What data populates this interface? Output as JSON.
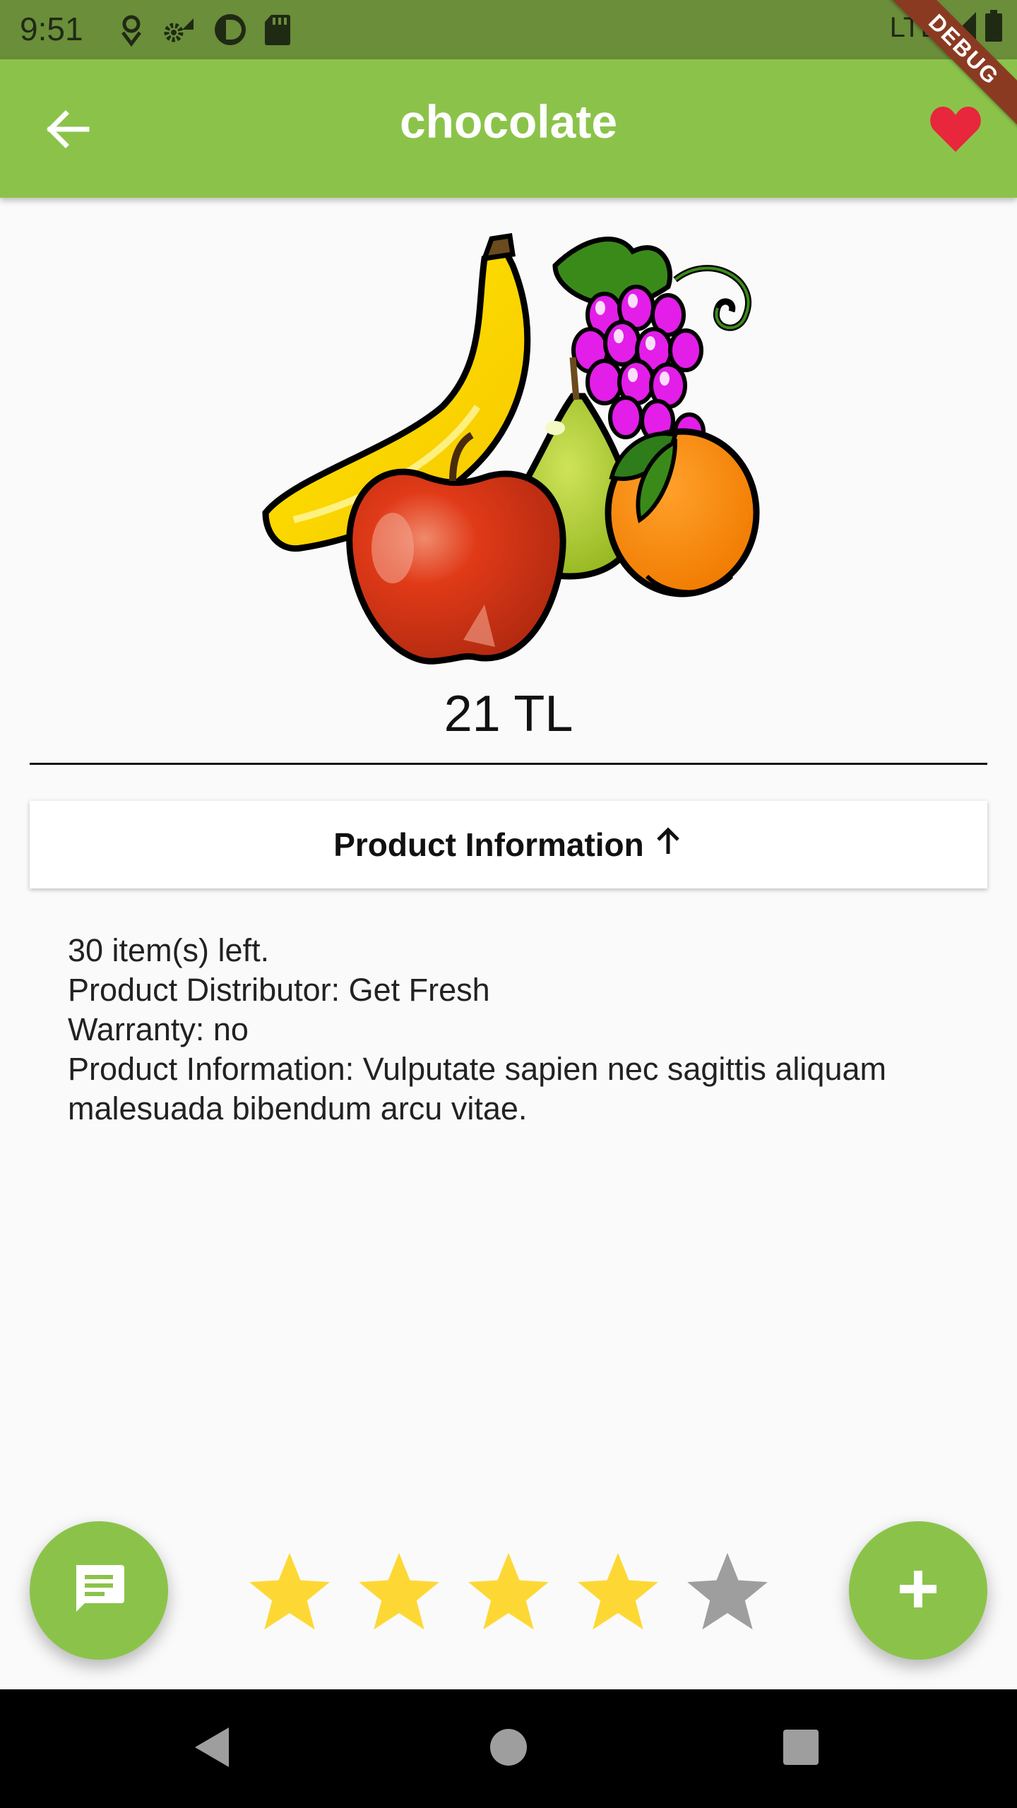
{
  "status_bar": {
    "time": "9:51",
    "network": "LTE",
    "icons": [
      "location-pin-icon",
      "settings-icon",
      "data-saver-icon",
      "sd-card-icon",
      "signal-icon",
      "battery-icon"
    ]
  },
  "app_bar": {
    "title": "chocolate",
    "back_icon": "arrow-left-icon",
    "favorite_icon": "heart-icon",
    "favorite_color": "#e8263c",
    "background_color": "#8bc34a"
  },
  "debug_banner": "DEBUG",
  "product": {
    "image": "fruit-basket-image",
    "price": "21 TL",
    "info_toggle_label": "Product Information",
    "info_toggle_icon": "arrow-up-icon",
    "info_lines": [
      "30 item(s) left.",
      "Product Distributor: Get Fresh",
      "Warranty: no",
      "Product Information: Vulputate sapien nec sagittis aliquam malesuada bibendum arcu vitae."
    ]
  },
  "rating": {
    "value": 4,
    "max": 5,
    "filled_color": "#fdd835",
    "empty_color": "#9e9e9e"
  },
  "fabs": {
    "chat_icon": "chat-icon",
    "add_icon": "plus-icon"
  },
  "navigation": {
    "back_icon": "nav-back-icon",
    "home_icon": "nav-home-icon",
    "recents_icon": "nav-recents-icon"
  }
}
